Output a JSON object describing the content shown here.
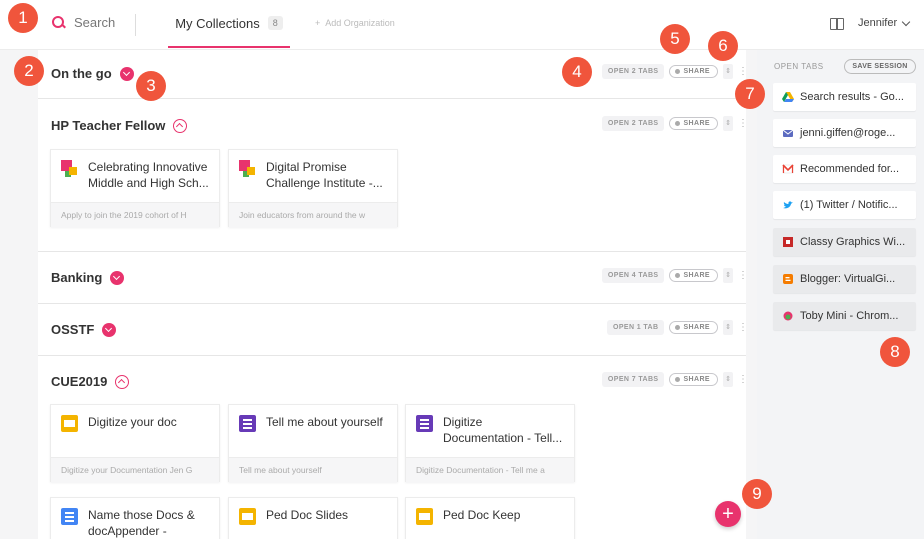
{
  "topbar": {
    "search_label": "Search",
    "active_tab_label": "My Collections",
    "collections_count": "8",
    "add_org_label": "Add Organization",
    "user_name": "Jennifer"
  },
  "right_panel": {
    "title": "OPEN TABS",
    "save_label": "SAVE SESSION",
    "tabs": [
      {
        "label": "Search results - Go...",
        "icon": "google-drive-icon"
      },
      {
        "label": "jenni.giffen@roge...",
        "icon": "mail-icon"
      },
      {
        "label": "Recommended for...",
        "icon": "gmail-icon"
      },
      {
        "label": "(1) Twitter / Notific...",
        "icon": "twitter-icon"
      },
      {
        "label": "Classy Graphics Wi...",
        "icon": "classy-graphics-icon"
      },
      {
        "label": "Blogger: VirtualGi...",
        "icon": "blogger-icon"
      },
      {
        "label": "Toby Mini - Chrom...",
        "icon": "toby-icon"
      }
    ]
  },
  "collections": [
    {
      "title": "On the go",
      "open_label": "OPEN 2 TABS",
      "share_label": "SHARE"
    },
    {
      "title": "HP Teacher Fellow",
      "open_label": "OPEN 2 TABS",
      "share_label": "SHARE",
      "cards": [
        {
          "title": "Celebrating Innovative Middle and High Sch...",
          "desc": "Apply to join the 2019 cohort of H"
        },
        {
          "title": "Digital Promise Challenge Institute -...",
          "desc": "Join educators from around the w"
        }
      ]
    },
    {
      "title": "Banking",
      "open_label": "OPEN 4 TABS",
      "share_label": "SHARE"
    },
    {
      "title": "OSSTF",
      "open_label": "OPEN 1 TAB",
      "share_label": "SHARE"
    },
    {
      "title": "CUE2019",
      "open_label": "OPEN 7 TABS",
      "share_label": "SHARE",
      "cards": [
        {
          "title": "Digitize your doc",
          "desc": "Digitize your Documentation Jen G"
        },
        {
          "title": "Tell me about yourself",
          "desc": "Tell me about yourself"
        },
        {
          "title": "Digitize Documentation - Tell...",
          "desc": "Digitize Documentation - Tell me a"
        },
        {
          "title": "Name those Docs & docAppender - Googl...",
          "desc": ""
        },
        {
          "title": "Ped Doc Slides",
          "desc": ""
        },
        {
          "title": "Ped Doc Keep",
          "desc": ""
        }
      ]
    }
  ],
  "callouts": [
    "1",
    "2",
    "3",
    "4",
    "5",
    "6",
    "7",
    "8",
    "9"
  ],
  "fab_label": "+",
  "colors": {
    "accent": "#e8336d",
    "callout": "#f0553c"
  }
}
